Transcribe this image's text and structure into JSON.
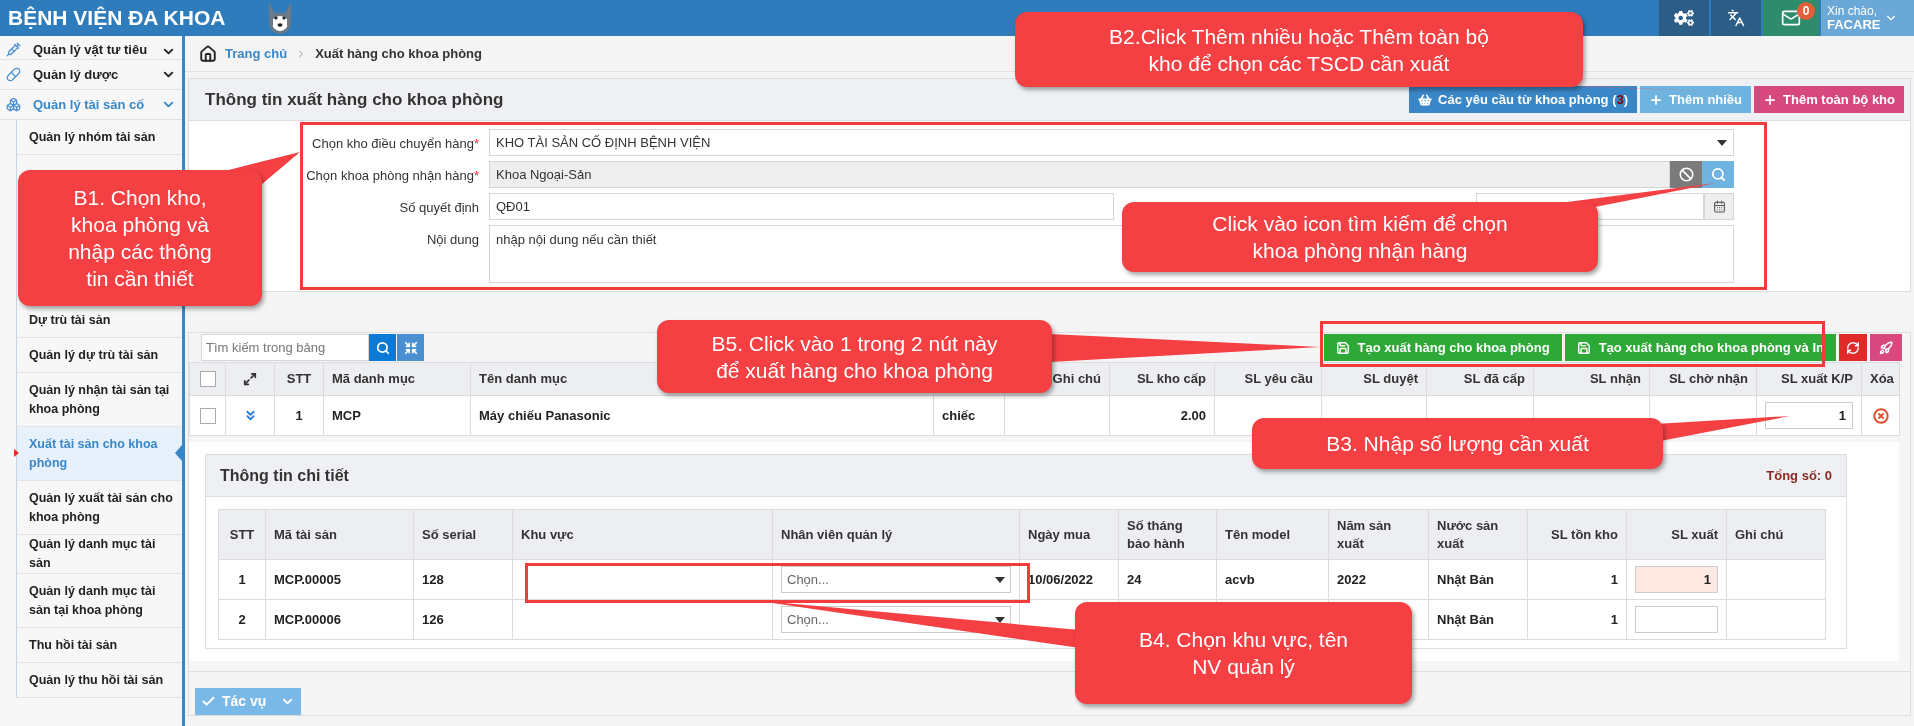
{
  "header": {
    "title": "BỆNH VIỆN ĐA KHOA",
    "mail_count": "0",
    "greeting": "Xin chào,",
    "user": "FACARE"
  },
  "sidebar": {
    "groups": [
      {
        "label": "Quản lý vật tư tiêu",
        "expanded": false
      },
      {
        "label": "Quản lý dược",
        "expanded": false
      },
      {
        "label": "Quản lý tài sản cố",
        "expanded": true
      }
    ],
    "items_top": [
      {
        "label": "Quản lý nhóm tài sản",
        "selected": false
      }
    ],
    "items": [
      {
        "label": "Dự trù tài sản",
        "selected": false
      },
      {
        "label": "Quản lý dự trù tài sản",
        "selected": false
      },
      {
        "label": "Quản lý nhận tài sản tại khoa phòng",
        "selected": false
      },
      {
        "label": "Xuất tài sản cho khoa phòng",
        "selected": true
      },
      {
        "label": "Quản lý xuất tài sản cho khoa phòng",
        "selected": false
      },
      {
        "label": "Quản lý danh mục tài sản",
        "selected": false
      },
      {
        "label": "Quản lý danh mục tài sản tại khoa phòng",
        "selected": false
      },
      {
        "label": "Thu hồi tài sản",
        "selected": false
      },
      {
        "label": "Quản lý thu hồi tài sản",
        "selected": false
      }
    ]
  },
  "breadcrumb": {
    "home": "Trang chủ",
    "current": "Xuất hàng cho khoa phòng"
  },
  "form_panel": {
    "title": "Thông tin xuất hàng cho khoa phòng",
    "buttons": [
      {
        "kind": "requests",
        "label": "Các yêu cầu từ khoa phòng (",
        "count": "3",
        "label_end": ")"
      },
      {
        "kind": "add_many",
        "label": "Thêm nhiều"
      },
      {
        "kind": "add_all",
        "label": "Thêm toàn bộ kho"
      }
    ],
    "fields": [
      {
        "kind": "select",
        "label": "Chọn kho điều chuyển hàng",
        "required_mark": "*",
        "value": "KHO TÀI SẢN CỐ ĐỊNH BỆNH VIỆN"
      },
      {
        "kind": "lookup",
        "label": "Chọn khoa phòng nhận hàng",
        "required_mark": "*",
        "value": "Khoa Ngoại-Sản"
      },
      {
        "kind": "text_date",
        "label": "Số quyết định",
        "value": "QĐ01"
      },
      {
        "kind": "textarea",
        "label": "Nội dung",
        "value": "nhập nội dung nếu cần thiết"
      }
    ]
  },
  "table_panel": {
    "search_placeholder": "Tìm kiếm trong bảng",
    "all_checked": false,
    "buttons": [
      {
        "kind": "create",
        "label": "Tạo xuất hàng cho khoa phòng"
      },
      {
        "kind": "create_print",
        "label": "Tạo xuất hàng cho khoa phòng và In"
      },
      {
        "kind": "refresh"
      },
      {
        "kind": "clear"
      }
    ],
    "columns": [
      "STT",
      "Mã danh mục",
      "Tên danh mục",
      "Ghi chú",
      "SL kho cấp",
      "SL yêu cầu",
      "SL duyệt",
      "SL đã cấp",
      "SL nhận",
      "SL chờ nhận",
      "SL xuất K/P",
      "Xóa"
    ],
    "rows": [
      {
        "checked": false,
        "expanded": true,
        "stt": "1",
        "code": "MCP",
        "name": "Máy chiếu Panasonic",
        "unit": "chiếc",
        "stock_issue": "2.00",
        "export_qty": "1"
      }
    ],
    "detail": {
      "title": "Thông tin chi tiết",
      "total": "Tổng số: 0",
      "columns": [
        "STT",
        "Mã tài sản",
        "Số serial",
        "Khu vực",
        "Nhân viên quản lý",
        "Ngày mua",
        "Số tháng bảo hành",
        "Tên model",
        "Năm sản xuất",
        "Nước sản xuất",
        "SL tồn kho",
        "SL xuất",
        "Ghi chú"
      ],
      "rows": [
        {
          "stt": "1",
          "asset_code": "MCP.00005",
          "serial": "128",
          "manager_placeholder": "Chọn...",
          "purchase_date": "10/06/2022",
          "warranty": "24",
          "model": "acvb",
          "year": "2022",
          "country": "Nhật Bản",
          "stock": "1",
          "export_qty": "1",
          "highlighted": true
        },
        {
          "stt": "2",
          "asset_code": "MCP.00006",
          "serial": "126",
          "manager_placeholder": "Chọn...",
          "country": "Nhật Bản",
          "stock": "1",
          "highlighted": false
        }
      ]
    },
    "action_button": "Tác vụ"
  },
  "callouts": [
    {
      "text": "B2.Click Thêm nhiều hoặc Thêm toàn bộ\nkho để chọn các TSCD cần xuất"
    },
    {
      "text": "B1. Chọn kho,\nkhoa phòng và\nnhập các thông\ntin cần thiết"
    },
    {
      "text": "Click vào icon tìm kiếm để chọn\nkhoa phòng nhận hàng"
    },
    {
      "text": "B5. Click vào 1 trong 2 nút này\nđể xuất hàng cho khoa phòng"
    },
    {
      "text": "B3. Nhập số lượng cần xuất"
    },
    {
      "text": "B4. Chọn khu vực, tên\nNV quản lý"
    }
  ]
}
